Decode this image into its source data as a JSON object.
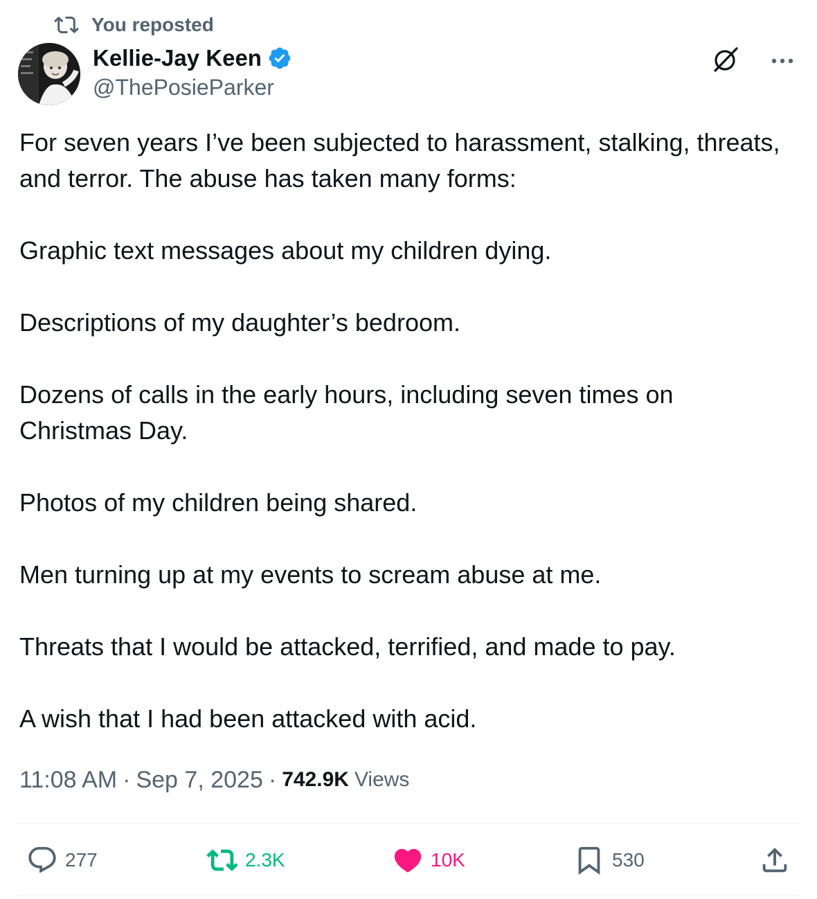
{
  "repost": {
    "label": "You reposted",
    "icon": "repost-icon"
  },
  "author": {
    "name": "Kellie-Jay Keen",
    "handle": "@ThePosieParker",
    "verified": true,
    "verified_color": "#1d9bf0"
  },
  "tweet": {
    "paragraphs": [
      "For seven years I’ve been subjected to harassment, stalking, threats, and terror. The abuse has taken many forms:",
      "Graphic text messages about my children dying.",
      "Descriptions of my daughter’s bedroom.",
      "Dozens of calls in the early hours, including seven times on Christmas Day.",
      "Photos of my children being shared.",
      "Men turning up at my events to scream abuse at me.",
      "Threats that I would be attacked, terrified, and made to pay.",
      "A wish that I had been attacked with acid."
    ]
  },
  "meta": {
    "time": "11:08 AM",
    "date": "Sep 7, 2025",
    "separator": "·",
    "views_count": "742.9K",
    "views_label": "Views"
  },
  "actions": {
    "replies": "277",
    "reposts": "2.3K",
    "likes": "10K",
    "bookmarks": "530"
  },
  "colors": {
    "text": "#0f1419",
    "secondary": "#536471",
    "repost_active": "#00ba7c",
    "like_active": "#f91880",
    "divider": "#eff3f4"
  }
}
